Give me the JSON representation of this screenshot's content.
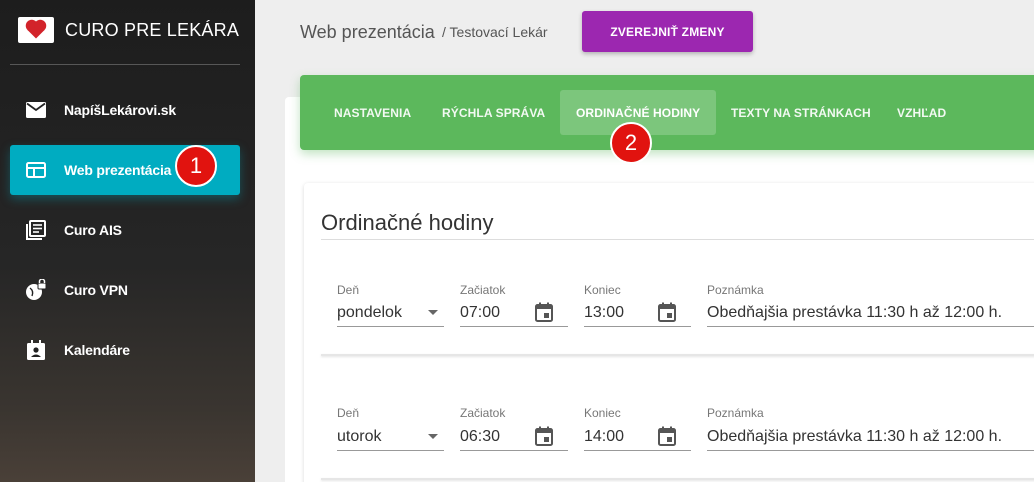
{
  "brand": {
    "title": "CURO PRE LEKÁRA",
    "logo_icon": "heart-logo-icon"
  },
  "sidebar": {
    "items": [
      {
        "label": "NapíšLekárovi.sk",
        "icon": "mail-icon"
      },
      {
        "label": "Web prezentácia",
        "icon": "web-icon",
        "active": true
      },
      {
        "label": "Curo AIS",
        "icon": "library-books-icon"
      },
      {
        "label": "Curo VPN",
        "icon": "vpn-lock-icon"
      },
      {
        "label": "Kalendáre",
        "icon": "calendar-person-icon"
      }
    ]
  },
  "badges": {
    "one": "1",
    "two": "2"
  },
  "header": {
    "title": "Web prezentácia",
    "subtitle": "/ Testovací Lekár",
    "publish_label": "ZVEREJNIŤ ZMENY"
  },
  "tabs": [
    {
      "label": "NASTAVENIA"
    },
    {
      "label": "RÝCHLA SPRÁVA"
    },
    {
      "label": "ORDINAČNÉ HODINY",
      "active": true
    },
    {
      "label": "TEXTY NA STRÁNKACH"
    },
    {
      "label": "VZHĽAD"
    }
  ],
  "section": {
    "title": "Ordinačné hodiny"
  },
  "labels": {
    "day": "Deň",
    "start": "Začiatok",
    "end": "Koniec",
    "note": "Poznámka"
  },
  "rows": [
    {
      "day": "pondelok",
      "start": "07:00",
      "end": "13:00",
      "note": "Obedňajšia prestávka 11:30 h až 12:00 h."
    },
    {
      "day": "utorok",
      "start": "06:30",
      "end": "14:00",
      "note": "Obedňajšia prestávka 11:30 h až 12:00 h."
    }
  ],
  "colors": {
    "accent_cyan": "#00acc1",
    "tab_green": "#5cb85c",
    "publish_purple": "#9c27b0",
    "badge_red": "#e1130f"
  }
}
